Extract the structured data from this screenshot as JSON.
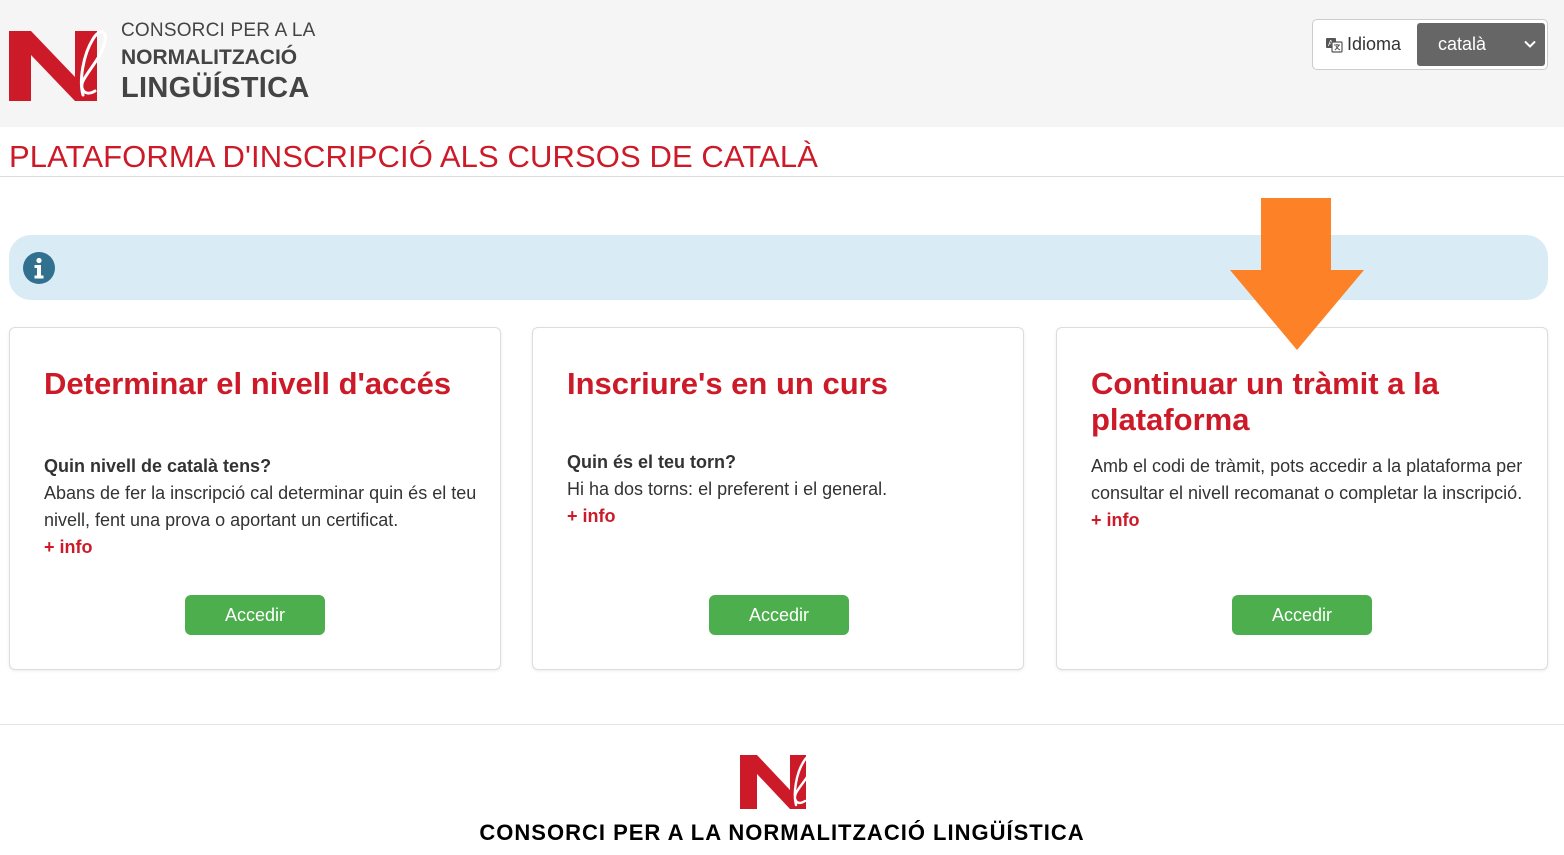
{
  "colors": {
    "brand_red": "#cc1a29",
    "button_green": "#4cae4c",
    "alert_blue": "#d9ecf6",
    "info_icon": "#31708f",
    "arrow_orange": "#fd8227"
  },
  "header": {
    "logo": {
      "line1": "CONSORCI PER A LA",
      "line2": "NORMALITZACIÓ",
      "line3": "LINGÜÍSTICA"
    },
    "language": {
      "label": "Idioma",
      "icon": "language-icon",
      "selected": "català"
    }
  },
  "page_title": "PLATAFORMA D'INSCRIPCIÓ ALS CURSOS DE CATALÀ",
  "alert": {
    "icon": "info-icon"
  },
  "cards": [
    {
      "title": "Determinar el nivell d'accés",
      "question": "Quin nivell de català tens?",
      "text": "Abans de fer la inscripció cal determinar quin és el teu nivell, fent una prova o aportant un certificat.",
      "more": "+ info",
      "button": "Accedir"
    },
    {
      "title": "Inscriure's en un curs",
      "question": "Quin és el teu torn?",
      "text": "Hi ha dos torns: el preferent i el general.",
      "more": "+ info",
      "button": "Accedir"
    },
    {
      "title": "Continuar un tràmit a la plataforma",
      "question": "",
      "text": "Amb el codi de tràmit, pots accedir a la plataforma per consultar el nivell recomanat o completar la inscripció.",
      "more": "+ info",
      "button": "Accedir"
    }
  ],
  "footer": {
    "name": "CONSORCI PER A LA NORMALITZACIÓ LINGÜÍSTICA"
  }
}
